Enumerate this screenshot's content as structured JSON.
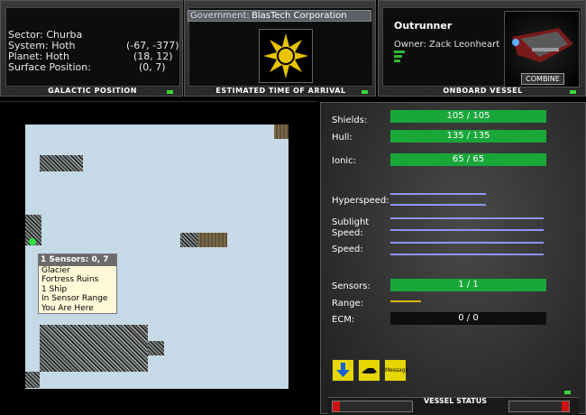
{
  "galactic": {
    "sector": "Sector: Churba",
    "system": "System: Hoth",
    "system_coords": "(-67, -377)",
    "planet": "Planet: Hoth",
    "planet_coords": "(18, 12)",
    "surface": "Surface Position:",
    "surface_coords": "(0, 7)",
    "label": "GALACTIC POSITION"
  },
  "eta": {
    "government_label": "Government:",
    "government_value": "BlasTech Corporation",
    "label": "ESTIMATED TIME OF ARRIVAL"
  },
  "vessel": {
    "name": "Outrunner",
    "owner": "Owner: Zack Leonheart",
    "ship_label": "COMBINE",
    "label": "ONBOARD VESSEL"
  },
  "map": {
    "tooltip_title": "1 Sensors: 0, 7",
    "tooltip_lines": [
      "Glacier",
      "Fortress Ruins",
      "1 Ship",
      "In Sensor Range",
      "You Are Here"
    ]
  },
  "status": {
    "shields_label": "Shields:",
    "shields_value": "105 / 105",
    "hull_label": "Hull:",
    "hull_value": "135 / 135",
    "ionic_label": "Ionic:",
    "ionic_value": "65 / 65",
    "hyperspeed_label": "Hyperspeed:",
    "sublight_label_1": "Sublight",
    "sublight_label_2": "Speed:",
    "speed_label": "Speed:",
    "sensors_label": "Sensors:",
    "sensors_value": "1 / 1",
    "range_label": "Range:",
    "ecm_label": "ECM:",
    "ecm_value": "0 / 0",
    "message_label": "Message",
    "panel_label": "VESSEL STATUS"
  },
  "colors": {
    "accent_green": "#19a73a",
    "speed_line": "#8c96ff",
    "emblem_gold": "#e8c400"
  }
}
